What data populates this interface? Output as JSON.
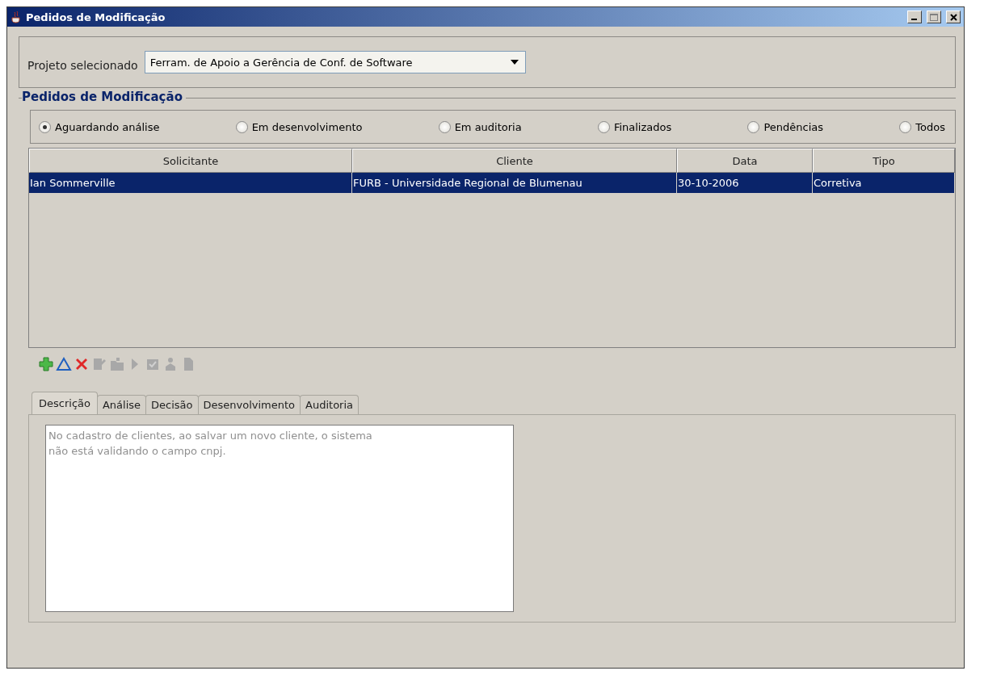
{
  "window": {
    "title": "Pedidos de Modificação"
  },
  "project": {
    "label": "Projeto selecionado",
    "value": "Ferram. de Apoio a Gerência de Conf. de Software"
  },
  "group": {
    "title": "Pedidos de Modificação"
  },
  "filters": [
    {
      "label": "Aguardando análise",
      "selected": true
    },
    {
      "label": "Em desenvolvimento",
      "selected": false
    },
    {
      "label": "Em auditoria",
      "selected": false
    },
    {
      "label": "Finalizados",
      "selected": false
    },
    {
      "label": "Pendências",
      "selected": false
    },
    {
      "label": "Todos",
      "selected": false
    }
  ],
  "table": {
    "columns": [
      "Solicitante",
      "Cliente",
      "Data",
      "Tipo"
    ],
    "rows": [
      {
        "cells": [
          "Ian Sommerville",
          "FURB - Universidade Regional de Blumenau",
          "30-10-2006",
          "Corretiva"
        ],
        "selected": true
      }
    ]
  },
  "toolbar": [
    {
      "kind": "add",
      "disabled": false
    },
    {
      "kind": "edit",
      "disabled": false
    },
    {
      "kind": "delete",
      "disabled": false
    },
    {
      "kind": "copy",
      "disabled": true
    },
    {
      "kind": "folder",
      "disabled": true
    },
    {
      "kind": "play",
      "disabled": true
    },
    {
      "kind": "check",
      "disabled": true
    },
    {
      "kind": "person",
      "disabled": true
    },
    {
      "kind": "document",
      "disabled": true
    }
  ],
  "tabs": [
    {
      "label": "Descrição",
      "selected": true
    },
    {
      "label": "Análise",
      "selected": false
    },
    {
      "label": "Decisão",
      "selected": false
    },
    {
      "label": "Desenvolvimento",
      "selected": false
    },
    {
      "label": "Auditoria",
      "selected": false
    }
  ],
  "description": {
    "value": "No cadastro de clientes, ao salvar um novo cliente, o sistema\nnão está validando o campo cnpj.",
    "disabled": true
  }
}
